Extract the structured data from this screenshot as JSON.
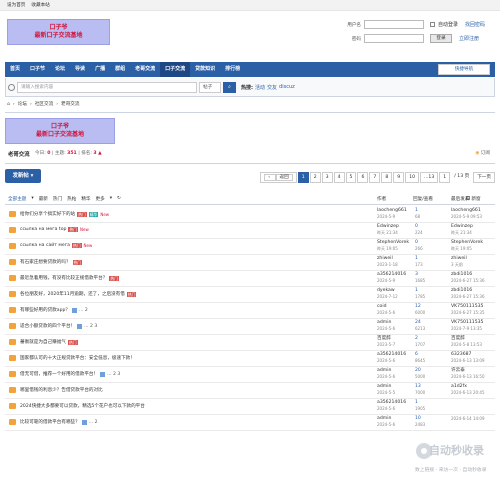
{
  "topbar": {
    "links": [
      "设为首页",
      "收藏本站"
    ]
  },
  "header": {
    "logo_line1": "口子爷",
    "logo_line2": "最新口子交流基地",
    "login": {
      "username_label": "用户名",
      "password_label": "密码",
      "auto_login": "自动登录",
      "find_password": "找回密码",
      "login_button": "登录",
      "register": "立即注册"
    }
  },
  "nav": {
    "items": [
      "首页",
      "口子节",
      "论坛",
      "导读",
      "广播",
      "群组",
      "老哥交流",
      "口子交流",
      "贷款知识",
      "排行榜"
    ],
    "active": "口子交流",
    "quick": "快捷导航"
  },
  "search": {
    "placeholder": "请输入搜索内容",
    "scope": "帖子",
    "hot_label": "热搜:",
    "hot": [
      "活动",
      "交友",
      "discuz"
    ]
  },
  "breadcrumb": [
    "论坛",
    "社区交流",
    "老哥交流"
  ],
  "forum": {
    "logo_line1": "口子爷",
    "logo_line2": "最新口子交流基地",
    "name": "老哥交流",
    "today_label": "今日:",
    "today": "0",
    "topics_label": "主题:",
    "topics": "351",
    "rank_label": "排名:",
    "rank": "3",
    "subscribe": "订阅"
  },
  "newpost": "发新帖",
  "pager": {
    "prev": "返回",
    "pages": [
      "1",
      "2",
      "3",
      "4",
      "5",
      "6",
      "7",
      "8",
      "9",
      "10",
      "...13"
    ],
    "jump_value": "1",
    "total": "/ 13 页",
    "next": "下一页"
  },
  "filter": {
    "tabs": [
      "全部主题",
      "最新",
      "热门",
      "热帖",
      "精华",
      "更多"
    ],
    "new_window": "新窗",
    "author": "作者",
    "reply_view": "回复/查看",
    "last_post": "最后发表"
  },
  "threads": [
    {
      "title": "给你们分享个搞实好下的站",
      "tags": [
        "热门",
        "精华"
      ],
      "new": "New",
      "pages": "",
      "author": "laocheng661",
      "date": "2024-5-9",
      "replies": "1",
      "views": "68",
      "last_user": "laocheng661",
      "last_date": "2024-5-9 09:53"
    },
    {
      "title": "ссылка на мега top",
      "tags": [
        "热门"
      ],
      "new": "New",
      "pages": "",
      "author": "Edwinzep",
      "date": "昨天 21:34",
      "replies": "0",
      "views": "224",
      "last_user": "Edwinzep",
      "last_date": "昨天 21:34"
    },
    {
      "title": "ссылка на сайт мега",
      "tags": [
        "热门"
      ],
      "new": "New",
      "pages": "",
      "author": "StephenVorek",
      "date": "昨天 19:05",
      "replies": "0",
      "views": "266",
      "last_user": "StephenVorek",
      "last_date": "昨天 19:05"
    },
    {
      "title": "有石家庄想要贷款的吗？",
      "tags": [
        "热门"
      ],
      "new": "",
      "pages": "",
      "author": "zhiweil",
      "date": "2023-1-18",
      "replies": "1",
      "views": "173",
      "last_user": "zhiweil",
      "last_date": "3 天前"
    },
    {
      "title": "最近急着用钱，有没有比较正规借款平台？",
      "tags": [
        "热门"
      ],
      "new": "",
      "pages": "",
      "author": "a356214016",
      "date": "2024-5-9",
      "replies": "3",
      "views": "1685",
      "last_user": "zbdi1016",
      "last_date": "2024-6-27 15:36"
    },
    {
      "title": "各位朋友好，2020年11月逾期，还了，之后没有借",
      "tags": [
        "热门"
      ],
      "new": "",
      "pages": "",
      "author": "dyekaw",
      "date": "2024-7-12",
      "replies": "1",
      "views": "1785",
      "last_user": "zbdi1016",
      "last_date": "2024-6-27 15:36"
    },
    {
      "title": "有哪些好用的贷款app？",
      "tags": [],
      "new": "",
      "pages": "... 2",
      "author": "coid",
      "date": "2024-5-6",
      "replies": "12",
      "views": "6000",
      "last_user": "VK750111535",
      "last_date": "2024-6-27 15:35"
    },
    {
      "title": "适合小额贷款的四个平台！",
      "tags": [],
      "new": "",
      "pages": "... 2 3",
      "author": "admin",
      "date": "2024-5-6",
      "replies": "24",
      "views": "6213",
      "last_user": "VK750111535",
      "last_date": "2024-7-9 13:35"
    },
    {
      "title": "蕃衡就是为自己赚福气",
      "tags": [
        "热门"
      ],
      "new": "",
      "pages": "",
      "author": "百度醉",
      "date": "2023-5-7",
      "replies": "2",
      "views": "1707",
      "last_user": "百度醉",
      "last_date": "2024-5-8 13:53"
    },
    {
      "title": "国家都认可的十大正规贷款平台：安全低息，极速下款！",
      "tags": [],
      "new": "",
      "pages": "",
      "author": "a356214016",
      "date": "2024-5-6",
      "replies": "6",
      "views": "8645",
      "last_user": "6323687",
      "last_date": "2024-6-13 13:09"
    },
    {
      "title": "借无可借，推荐一个好用的借款平台！",
      "tags": [],
      "new": "",
      "pages": "... 2 3",
      "author": "admin",
      "date": "2024-5-6",
      "replies": "20",
      "views": "5000",
      "last_user": "许云泰",
      "last_date": "2024-6-13 16:50"
    },
    {
      "title": "哪里借钱的利息少？告借贷款平台的对比",
      "tags": [],
      "new": "",
      "pages": "",
      "author": "admin",
      "date": "2024-5-5",
      "replies": "13",
      "views": "7000",
      "last_user": "a1d2fx",
      "last_date": "2024-6-13 20:45"
    },
    {
      "title": "2024快捷大多都要可以贷款，精选5个花户也可以下款的平台",
      "tags": [],
      "new": "",
      "pages": "",
      "author": "a356214016",
      "date": "2024-5-6",
      "replies": "1",
      "views": "1905",
      "last_user": "",
      "last_date": ""
    },
    {
      "title": "比较可靠的借款平台有哪些？",
      "tags": [],
      "new": "",
      "pages": "... 2",
      "author": "admin",
      "date": "2024-5-6",
      "replies": "10",
      "views": "2483",
      "last_user": "",
      "last_date": "2024-6-14 14:09"
    }
  ],
  "watermark": {
    "title": "自动秒收录",
    "subtitle": "数上链接 · 来访一次 · 自动秒收录"
  }
}
